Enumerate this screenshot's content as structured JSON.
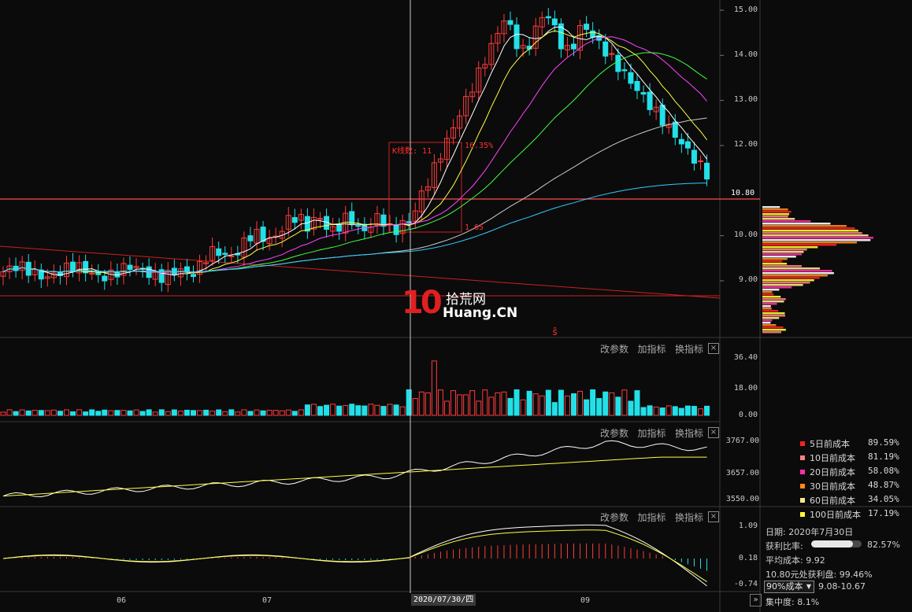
{
  "price_panel": {
    "y_ticks": [
      "15.00",
      "14.00",
      "13.00",
      "12.00",
      "10.00",
      "9.00"
    ],
    "current_price": "10.80",
    "box_label": "K线数: 11",
    "box_pct": "16.35%",
    "box_low": "1.65",
    "marker": "ŝ",
    "watermark_main": "10",
    "watermark_cn": "拾荒网",
    "watermark_en": "Huang.CN",
    "colors": {
      "up": "#ff3b3b",
      "down": "#22e0e8",
      "bg": "#0b0b0b"
    }
  },
  "toolbar": {
    "edit_params": "改参数",
    "add_indicator": "加指标",
    "switch_indicator": "换指标",
    "close": "×"
  },
  "volume_panel": {
    "y_ticks": [
      "36.40",
      "18.00",
      "0.00"
    ]
  },
  "index_panel": {
    "y_ticks": [
      "3767.00",
      "3657.00",
      "3550.00"
    ]
  },
  "macd_panel": {
    "y_ticks": [
      "1.09",
      "0.18",
      "-0.74"
    ]
  },
  "x_axis": {
    "labels": [
      "06",
      "07",
      "09"
    ],
    "cursor_date": "2020/07/30/四",
    "nav": "»"
  },
  "cost_legend": [
    {
      "label": "5日前成本",
      "pct": "89.59%",
      "color": "#ff2020"
    },
    {
      "label": "10日前成本",
      "pct": "81.19%",
      "color": "#ff8080"
    },
    {
      "label": "20日前成本",
      "pct": "58.08%",
      "color": "#ff2fa8"
    },
    {
      "label": "30日前成本",
      "pct": "48.87%",
      "color": "#ff8a1c"
    },
    {
      "label": "60日前成本",
      "pct": "34.05%",
      "color": "#ffe68a"
    },
    {
      "label": "100日前成本",
      "pct": "17.19%",
      "color": "#ffff30"
    }
  ],
  "chip_info": {
    "date": "日期: 2020年7月30日",
    "profit_ratio_label": "获利比率:",
    "profit_ratio_value": "82.57%",
    "profit_ratio": 0.8257,
    "avg_cost": "平均成本: 9.92",
    "profit_at": "10.80元处获利盘: 99.46%",
    "cost_select": "90%成本",
    "cost_range": "9.08-10.67",
    "concentration": "集中度: 8.1%"
  }
}
